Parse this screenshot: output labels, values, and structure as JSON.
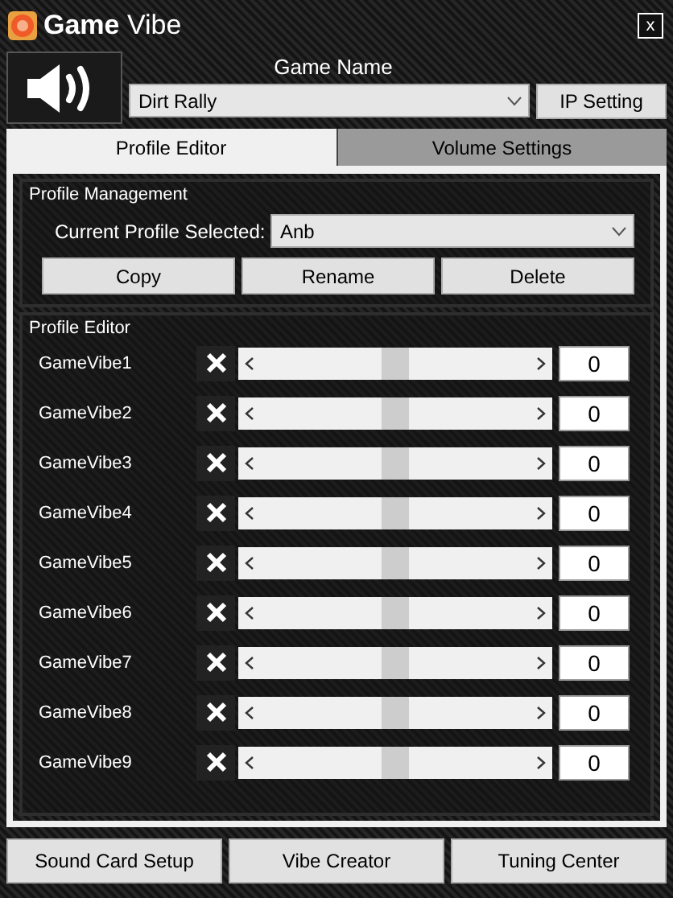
{
  "window": {
    "title_bold": "Game",
    "title_rest": "Vibe",
    "close": "x"
  },
  "game": {
    "label": "Game Name",
    "value": "Dirt Rally",
    "ip_button": "IP Setting"
  },
  "tabs": [
    {
      "label": "Profile Editor",
      "selected": true
    },
    {
      "label": "Volume Settings",
      "selected": false
    }
  ],
  "profile_management": {
    "title": "Profile Management",
    "current_label": "Current Profile Selected:",
    "current_value": "Anb",
    "buttons": [
      "Copy",
      "Rename",
      "Delete"
    ]
  },
  "profile_editor": {
    "title": "Profile Editor",
    "channels": [
      {
        "name": "GameVibe1",
        "level": 0.5,
        "value": "0"
      },
      {
        "name": "GameVibe2",
        "level": 0.5,
        "value": "0"
      },
      {
        "name": "GameVibe3",
        "level": 0.5,
        "value": "0"
      },
      {
        "name": "GameVibe4",
        "level": 0.5,
        "value": "0"
      },
      {
        "name": "GameVibe5",
        "level": 0.5,
        "value": "0"
      },
      {
        "name": "GameVibe6",
        "level": 0.5,
        "value": "0"
      },
      {
        "name": "GameVibe7",
        "level": 0.5,
        "value": "0"
      },
      {
        "name": "GameVibe8",
        "level": 0.5,
        "value": "0"
      },
      {
        "name": "GameVibe9",
        "level": 0.5,
        "value": "0"
      }
    ]
  },
  "bottom_buttons": [
    "Sound Card Setup",
    "Vibe Creator",
    "Tuning Center"
  ]
}
